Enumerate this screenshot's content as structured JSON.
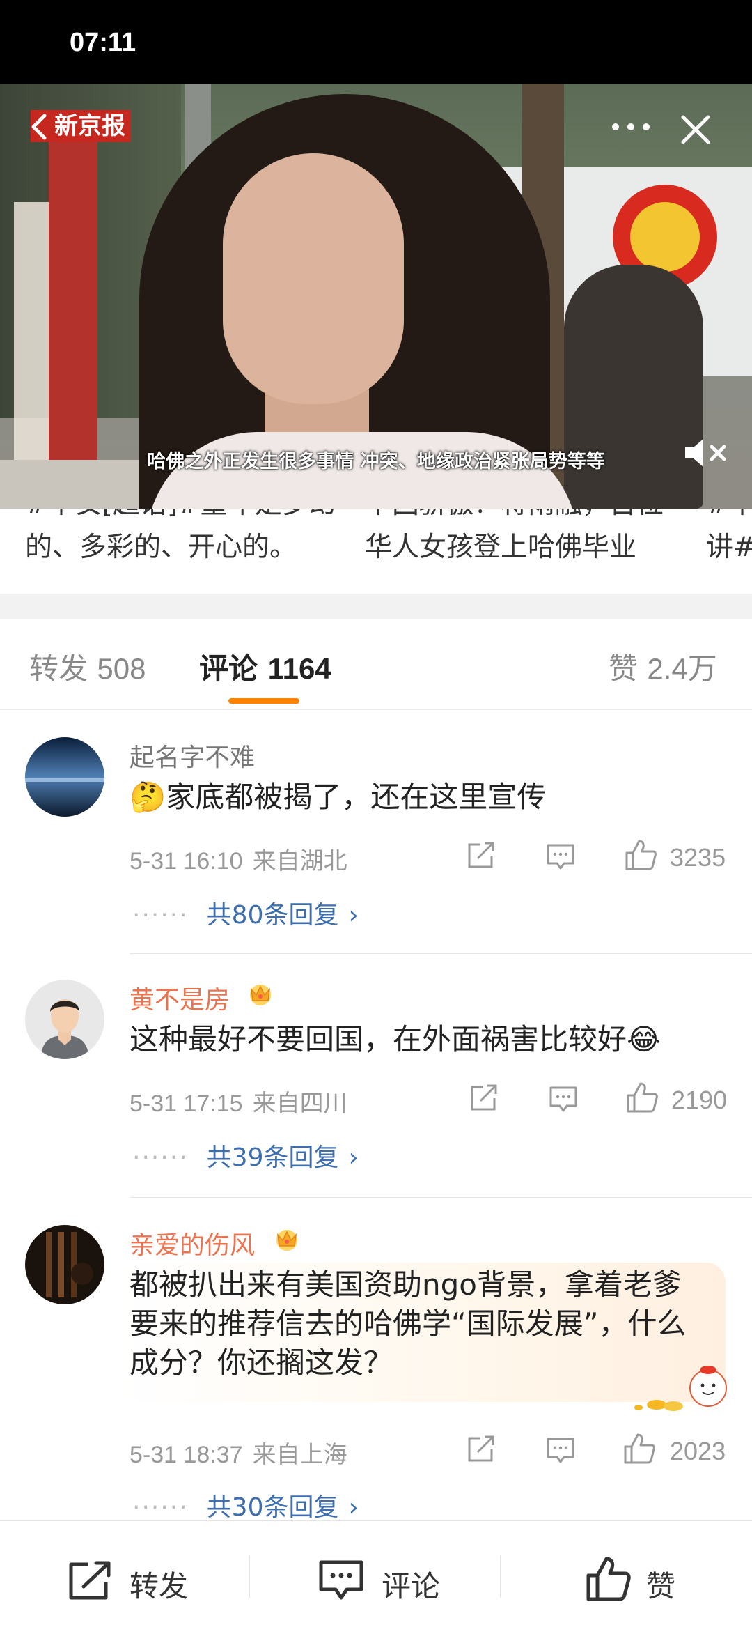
{
  "status_bar": {
    "time": "07:11"
  },
  "video": {
    "badge": "新京报",
    "subtitle": "哈佛之外正发生很多事情 冲突、地缘政治紧张局势等等"
  },
  "cards": [
    {
      "line1": "#早安[超话]#童年是梦幻",
      "line2": "的、多彩的、开心的。"
    },
    {
      "line1": "中国骄傲！蒋雨融，首位",
      "line2": "华人女孩登上哈佛毕业"
    },
    {
      "line1": "#中",
      "line2": "讲#"
    }
  ],
  "tabs": {
    "repost": {
      "label": "转发",
      "count": "508"
    },
    "comment": {
      "label": "评论",
      "count": "1164"
    },
    "like": {
      "label": "赞",
      "count": "2.4万"
    }
  },
  "comments": [
    {
      "user": "起名字不难",
      "text": "🤔家底都被揭了，还在这里宣传",
      "time": "5-31 16:10",
      "location": "来自湖北",
      "likes": "3235",
      "replies": "共80条回复"
    },
    {
      "user": "黄不是房",
      "text": "这种最好不要回国，在外面祸害比较好😂",
      "time": "5-31 17:15",
      "location": "来自四川",
      "likes": "2190",
      "replies": "共39条回复"
    },
    {
      "user": "亲爱的伤风",
      "text": "都被扒出来有美国资助ngo背景，拿着老爹要来的推荐信去的哈佛学“国际发展”，什么成分？你还搁这发？",
      "time": "5-31 18:37",
      "location": "来自上海",
      "likes": "2023",
      "replies": "共30条回复"
    }
  ],
  "reply_dots": "······",
  "reply_arrow": "›",
  "bottom_bar": {
    "repost": "转发",
    "comment": "评论",
    "like": "赞"
  },
  "colors": {
    "accent": "#ff8200",
    "vip_name": "#eb7350",
    "link": "#3d6fb0",
    "badge": "#c6271f"
  }
}
